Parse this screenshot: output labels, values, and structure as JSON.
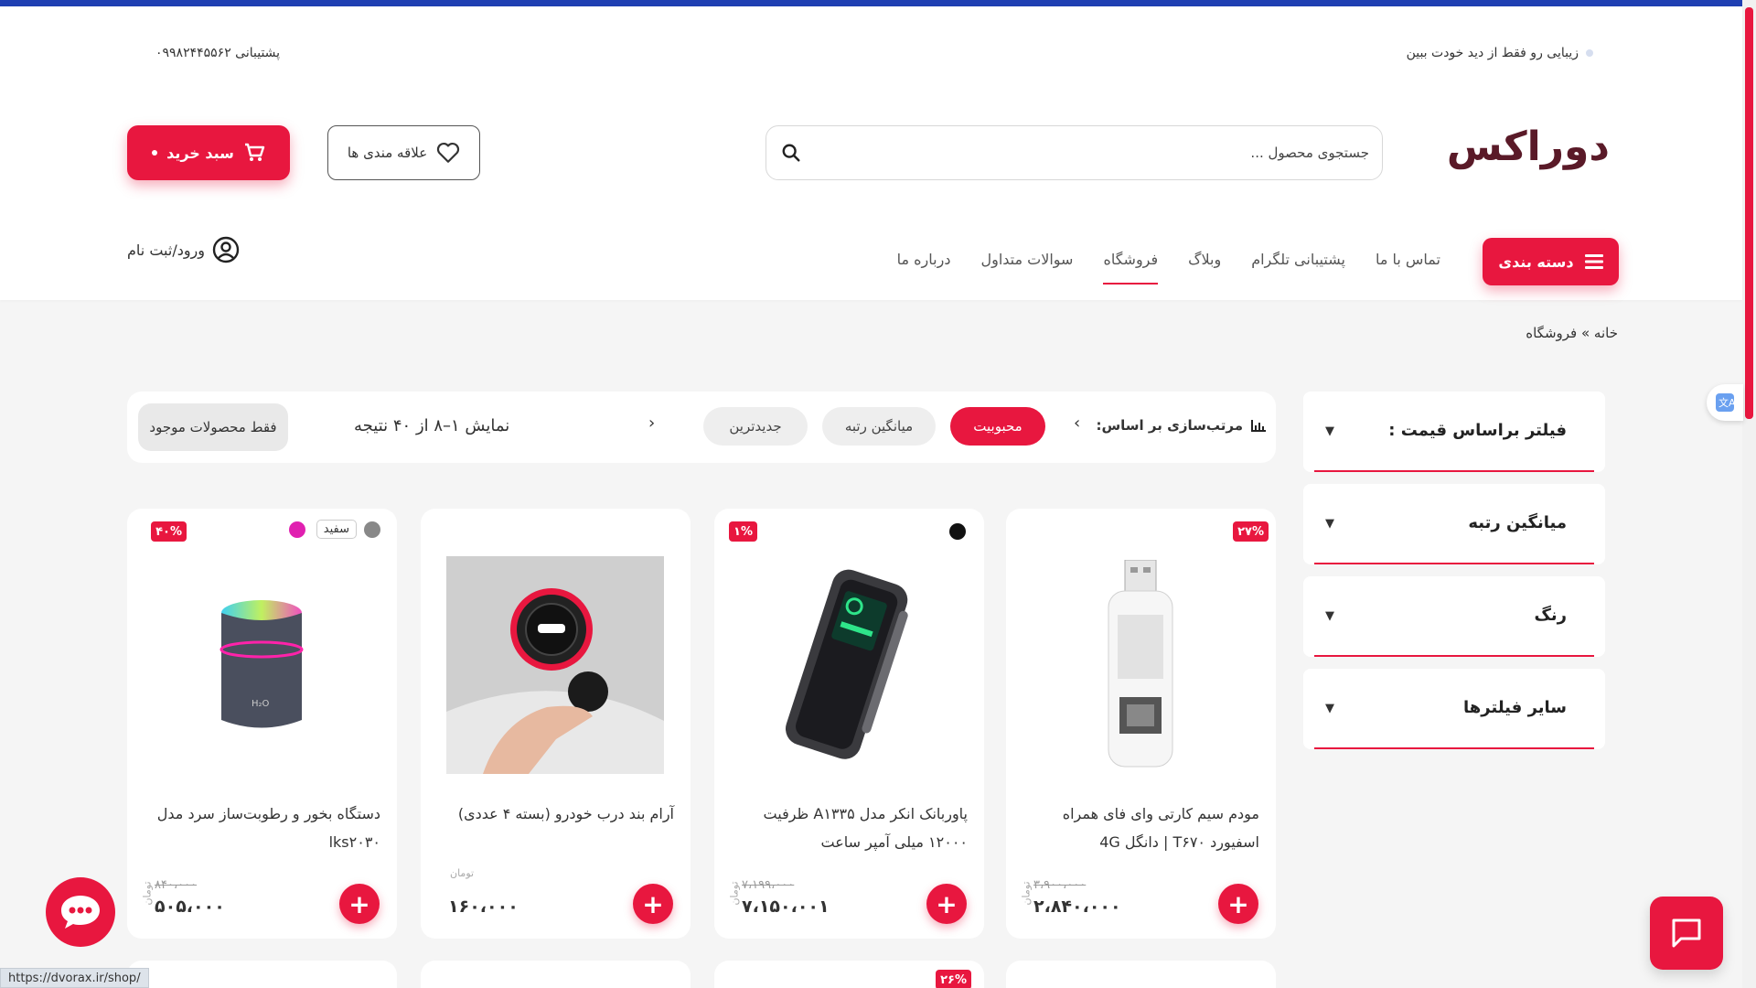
{
  "header": {
    "tagline": "زیبایی رو فقط از دید خودت ببین",
    "support": "پشتیبانی ۰۹۹۸۲۴۴۵۵۶۲",
    "logo_text": "دوراکس",
    "search_placeholder": "جستجوی محصول ...",
    "wishlist_label": "علاقه مندی ها",
    "cart_label": "سبد خرید",
    "category_button": "دسته بندی",
    "nav": [
      "تماس با ما",
      "پشتیبانی تلگرام",
      "وبلاگ",
      "فروشگاه",
      "سوالات متداول",
      "درباره ما"
    ],
    "nav_active": "فروشگاه",
    "login_label": "ورود/ثبت نام"
  },
  "breadcrumb": "خانه » فروشگاه",
  "sortbar": {
    "label": "مرتب‌سازی بر اساس:",
    "options": [
      "محبوبیت",
      "میانگین رتبه",
      "جدیدترین"
    ],
    "active": "محبوبیت",
    "result_count": "نمایش ۱–۸ از ۴۰ نتیجه",
    "in_stock_label": "فقط محصولات موجود"
  },
  "filters": [
    "فیلتر براساس قیمت :",
    "میانگین رتبه",
    "رنگ",
    "سایر فیلترها"
  ],
  "products": [
    {
      "title": "مودم سیم کارتی وای فای همراه اسفیورد T۶۷۰ | دانگل 4G",
      "badge": "۲۷%",
      "old_price": "۳،۹۰۰،۰۰۰",
      "price": "۲،۸۴۰،۰۰۰",
      "unit": "تومان"
    },
    {
      "title": "پاوربانک انکر مدل A۱۳۳۵ ظرفیت ۱۲۰۰۰ میلی آمپر ساعت",
      "badge": "۱%",
      "old_price": "۷،۱۹۹،۰۰۰",
      "price": "۷،۱۵۰،۰۰۱",
      "unit": "تومان",
      "color_dot": "#111111"
    },
    {
      "title": "آرام بند درب خودرو (بسته ۴ عددی)",
      "badge": "",
      "old_price": "",
      "price": "۱۶۰،۰۰۰",
      "unit": "تومان"
    },
    {
      "title": "دستگاه بخور و رطوبت‌ساز سرد مدل lks۲۰۳۰",
      "badge": "۴۰%",
      "old_price": "۸۴۰،۰۰۰",
      "price": "۵۰۵،۰۰۰",
      "unit": "تومان",
      "color_label": "سفید"
    }
  ],
  "partial_badge": "۲۶%",
  "status_url": "https://dvorax.ir/shop/",
  "colors": {
    "accent": "#e8173f",
    "top_line": "#1f3fb2"
  }
}
